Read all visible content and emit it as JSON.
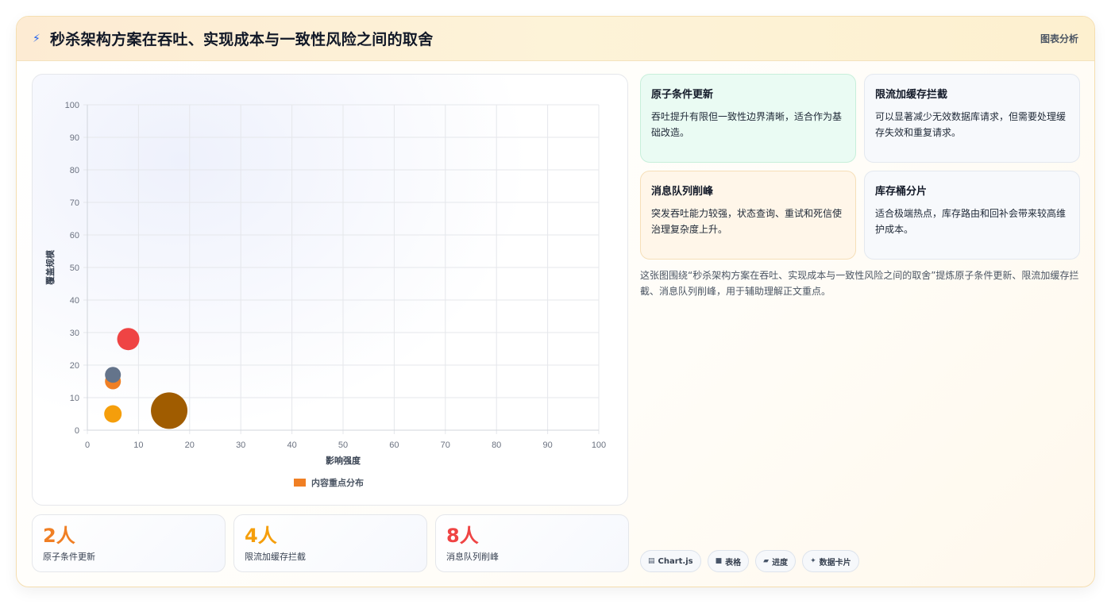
{
  "header": {
    "title": "秒杀架构方案在吞吐、实现成本与一致性风险之间的取舍",
    "title_icon": "lightning-icon",
    "tag": "图表分析"
  },
  "chart_data": {
    "type": "scatter",
    "title": "",
    "xlabel": "影响强度",
    "ylabel": "覆盖规模",
    "xlim": [
      0,
      100
    ],
    "ylim": [
      0,
      100
    ],
    "x_ticks": [
      "0",
      "10",
      "20",
      "30",
      "40",
      "50",
      "60",
      "70",
      "80",
      "90",
      "100"
    ],
    "y_ticks": [
      "0",
      "10",
      "20",
      "30",
      "40",
      "50",
      "60",
      "70",
      "80",
      "90",
      "100"
    ],
    "grid": true,
    "legend": {
      "label": "内容重点分布",
      "color": "#f07f24",
      "position": "bottom"
    },
    "points": [
      {
        "x": 8,
        "y": 28,
        "size": 14,
        "color": "#ef4444"
      },
      {
        "x": 5,
        "y": 15,
        "size": 10,
        "color": "#f07f24"
      },
      {
        "x": 5,
        "y": 17,
        "size": 10,
        "color": "#64748b"
      },
      {
        "x": 5,
        "y": 5,
        "size": 11,
        "color": "#f59e0b"
      },
      {
        "x": 16,
        "y": 6,
        "size": 23,
        "color": "#a05c00"
      }
    ]
  },
  "stats": [
    {
      "value": "2人",
      "label": "原子条件更新",
      "color": "#f07f24"
    },
    {
      "value": "4人",
      "label": "限流加缓存拦截",
      "color": "#f59e0b"
    },
    {
      "value": "8人",
      "label": "消息队列削峰",
      "color": "#ef4444"
    }
  ],
  "cards": [
    {
      "title": "原子条件更新",
      "body": "吞吐提升有限但一致性边界清晰，适合作为基础改造。"
    },
    {
      "title": "限流加缓存拦截",
      "body": "可以显著减少无效数据库请求，但需要处理缓存失效和重复请求。"
    },
    {
      "title": "消息队列削峰",
      "body": "突发吞吐能力较强，状态查询、重试和死信使治理复杂度上升。"
    },
    {
      "title": "库存桶分片",
      "body": "适合极端热点，库存路由和回补会带来较高维护成本。"
    }
  ],
  "summary": "这张图围绕“秒杀架构方案在吞吐、实现成本与一致性风险之间的取舍”提炼原子条件更新、限流加缓存拦截、消息队列削峰，用于辅助理解正文重点。",
  "chips": [
    {
      "icon": "chart-icon",
      "glyph": "▤",
      "label": "Chart.js"
    },
    {
      "icon": "table-icon",
      "glyph": "■",
      "label": "表格"
    },
    {
      "icon": "progress-icon",
      "glyph": "▰",
      "label": "进度"
    },
    {
      "icon": "card-icon",
      "glyph": "✦",
      "label": "数据卡片"
    }
  ]
}
